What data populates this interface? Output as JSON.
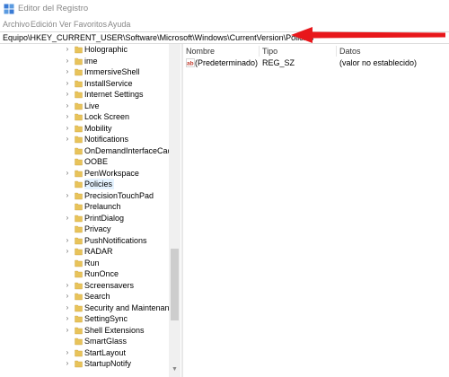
{
  "window": {
    "title": "Editor del Registro"
  },
  "menu": [
    "Archivo",
    "Edición",
    "Ver",
    "Favoritos",
    "Ayuda"
  ],
  "address": {
    "path": "Equipo\\HKEY_CURRENT_USER\\Software\\Microsoft\\Windows\\CurrentVersion\\Policies"
  },
  "tree": {
    "items": [
      {
        "label": "Holographic",
        "expandable": true
      },
      {
        "label": "ime",
        "expandable": true
      },
      {
        "label": "ImmersiveShell",
        "expandable": true
      },
      {
        "label": "InstallService",
        "expandable": true
      },
      {
        "label": "Internet Settings",
        "expandable": true
      },
      {
        "label": "Live",
        "expandable": true
      },
      {
        "label": "Lock Screen",
        "expandable": true
      },
      {
        "label": "Mobility",
        "expandable": true
      },
      {
        "label": "Notifications",
        "expandable": true
      },
      {
        "label": "OnDemandInterfaceCach",
        "expandable": false
      },
      {
        "label": "OOBE",
        "expandable": false
      },
      {
        "label": "PenWorkspace",
        "expandable": true
      },
      {
        "label": "Policies",
        "expandable": false,
        "selected": true
      },
      {
        "label": "PrecisionTouchPad",
        "expandable": true
      },
      {
        "label": "Prelaunch",
        "expandable": false
      },
      {
        "label": "PrintDialog",
        "expandable": true
      },
      {
        "label": "Privacy",
        "expandable": false
      },
      {
        "label": "PushNotifications",
        "expandable": true
      },
      {
        "label": "RADAR",
        "expandable": true
      },
      {
        "label": "Run",
        "expandable": false
      },
      {
        "label": "RunOnce",
        "expandable": false
      },
      {
        "label": "Screensavers",
        "expandable": true
      },
      {
        "label": "Search",
        "expandable": true
      },
      {
        "label": "Security and Maintenanc",
        "expandable": true
      },
      {
        "label": "SettingSync",
        "expandable": true
      },
      {
        "label": "Shell Extensions",
        "expandable": true
      },
      {
        "label": "SmartGlass",
        "expandable": false
      },
      {
        "label": "StartLayout",
        "expandable": true
      },
      {
        "label": "StartupNotify",
        "expandable": true
      }
    ]
  },
  "list": {
    "columns": [
      "Nombre",
      "Tipo",
      "Datos"
    ],
    "rows": [
      {
        "name": "(Predeterminado)",
        "type": "REG_SZ",
        "data": "(valor no establecido)"
      }
    ]
  },
  "colors": {
    "selection": "#e5f3ff",
    "folder": "#e8c35a",
    "arrow": "#e8171b",
    "value_icon": "#c0392b"
  }
}
